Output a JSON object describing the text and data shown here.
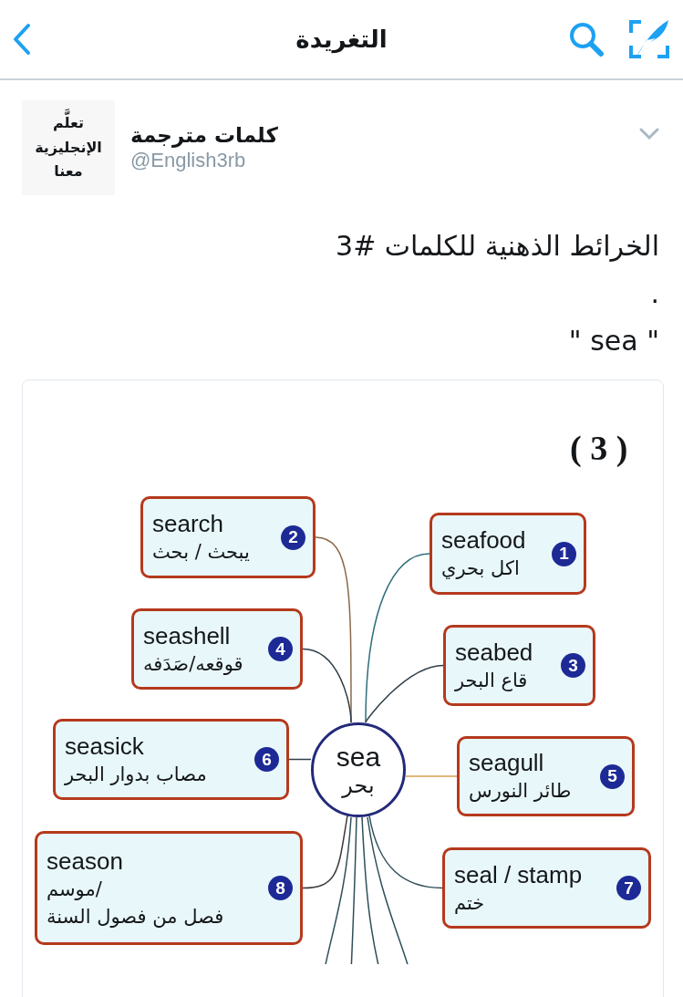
{
  "header": {
    "title": "التغريدة"
  },
  "tweet": {
    "author": {
      "name": "كلمات مترجمة",
      "handle": "@English3rb",
      "avatar_lines": [
        "تعلَّم",
        "الإنجليزية",
        "معنا"
      ]
    },
    "text_lines": [
      "الخرائط الذهنية للكلمات #3",
      ".",
      "\" sea \""
    ],
    "mind_map": {
      "label": "( 3 )",
      "center": {
        "english": "sea",
        "arabic": "بحر"
      },
      "nodes": [
        {
          "number": "1",
          "english": "seafood",
          "arabic": [
            "اكل بحري"
          ]
        },
        {
          "number": "2",
          "english": "search",
          "arabic": [
            "يبحث / بحث"
          ]
        },
        {
          "number": "3",
          "english": "seabed",
          "arabic": [
            "قاع البحر"
          ]
        },
        {
          "number": "4",
          "english": "seashell",
          "arabic": [
            "قوقعه/صَدَفه"
          ]
        },
        {
          "number": "5",
          "english": "seagull",
          "arabic": [
            "طائر النورس"
          ]
        },
        {
          "number": "6",
          "english": "seasick",
          "arabic": [
            "مصاب بدوار البحر"
          ]
        },
        {
          "number": "7",
          "english": "seal / stamp",
          "arabic": [
            "ختم"
          ]
        },
        {
          "number": "8",
          "english": "season",
          "arabic": [
            "/موسم",
            "فصل من فصول السنة"
          ]
        }
      ]
    }
  }
}
